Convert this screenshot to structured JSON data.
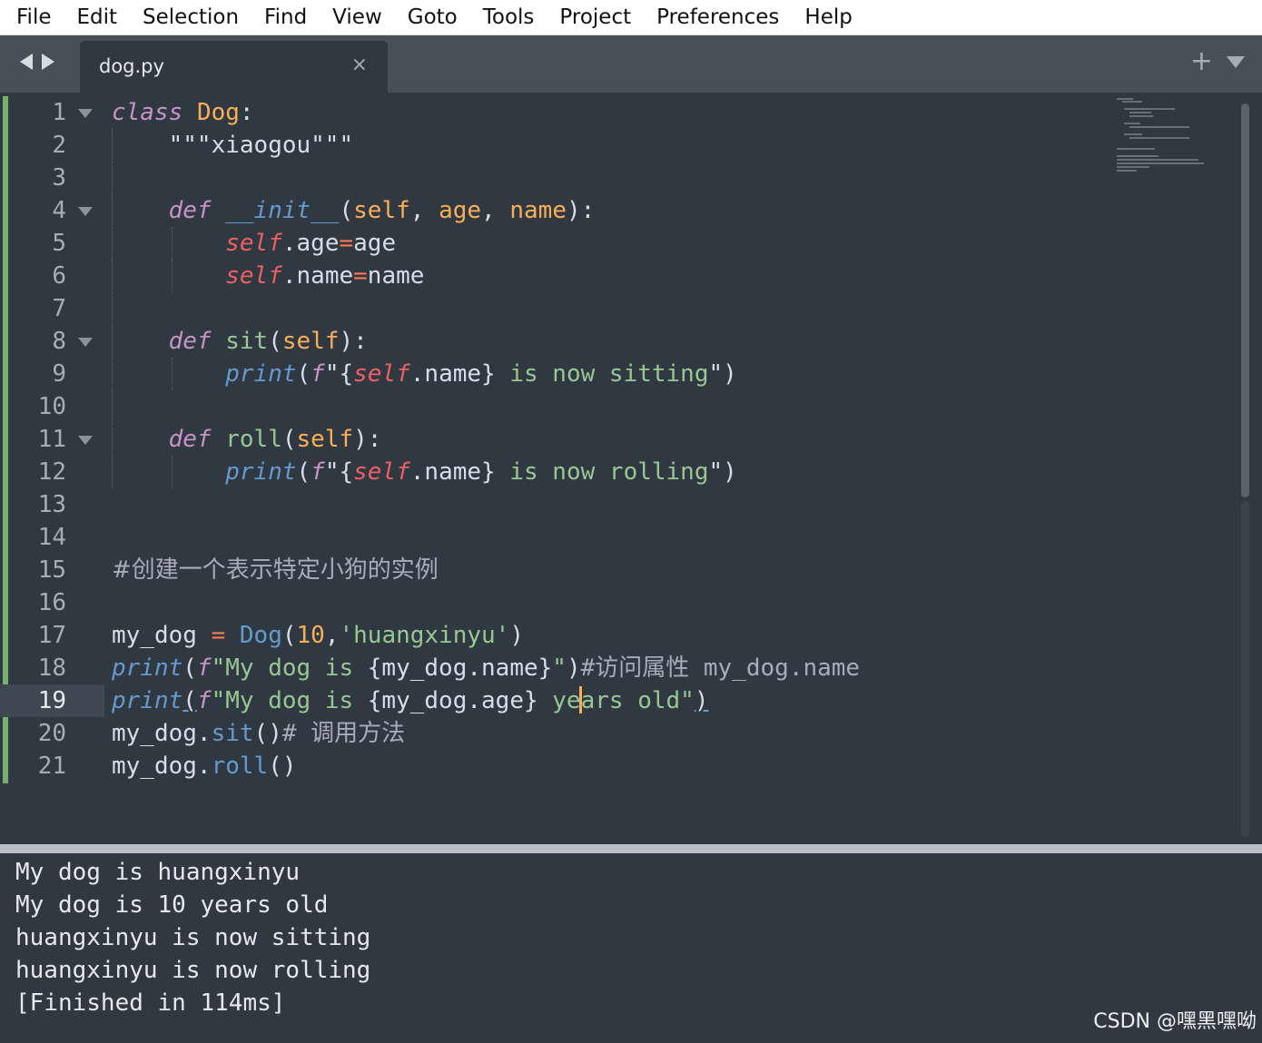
{
  "menu": [
    "File",
    "Edit",
    "Selection",
    "Find",
    "View",
    "Goto",
    "Tools",
    "Project",
    "Preferences",
    "Help"
  ],
  "tab": {
    "title": "dog.py",
    "close_glyph": "×",
    "plus_glyph": "+"
  },
  "editor": {
    "active_line": 19,
    "line_numbers": [
      "1",
      "2",
      "3",
      "4",
      "5",
      "6",
      "7",
      "8",
      "9",
      "10",
      "11",
      "12",
      "13",
      "14",
      "15",
      "16",
      "17",
      "18",
      "19",
      "20",
      "21"
    ],
    "lines": {
      "l1": [
        "class",
        " ",
        "Dog",
        ":"
      ],
      "l2": [
        "\"\"\"xiaogou\"\"\""
      ],
      "l4": [
        "def",
        " ",
        "__init__",
        "(",
        "self",
        ", ",
        "age",
        ", ",
        "name",
        "):"
      ],
      "l5": [
        "self",
        ".age",
        "=",
        "age"
      ],
      "l6": [
        "self",
        ".name",
        "=",
        "name"
      ],
      "l8": [
        "def",
        " ",
        "sit",
        "(",
        "self",
        "):"
      ],
      "l9": [
        "print",
        "(",
        "f",
        "\"",
        "{",
        "self",
        ".name}",
        " is now sitting",
        "\"",
        ")"
      ],
      "l11": [
        "def",
        " ",
        "roll",
        "(",
        "self",
        "):"
      ],
      "l12": [
        "print",
        "(",
        "f",
        "\"",
        "{",
        "self",
        ".name}",
        " is now rolling",
        "\"",
        ")"
      ],
      "l15": [
        "#创建一个表示特定小狗的实例"
      ],
      "l17": [
        "my_dog",
        " ",
        "=",
        " ",
        "Dog",
        "(",
        "10",
        ",",
        "'huangxinyu'",
        ")"
      ],
      "l18": [
        "print",
        "(",
        "f",
        "\"My dog is ",
        "{my_dog.name}",
        "\"",
        ")",
        "#访问属性 my_dog.name"
      ],
      "l19": [
        "print",
        "(",
        "f",
        "\"My dog is ",
        "{my_dog.age}",
        " ye",
        "ars old\"",
        ")"
      ],
      "l20": [
        "my_dog",
        ".",
        "sit",
        "()",
        "# 调用方法"
      ],
      "l21": [
        "my_dog",
        ".",
        "roll",
        "()"
      ]
    }
  },
  "output": [
    "My dog is huangxinyu",
    "My dog is 10 years old",
    "huangxinyu is now sitting",
    "huangxinyu is now rolling",
    "[Finished in 114ms]"
  ],
  "watermark": "CSDN @嘿黑嘿呦",
  "colors": {
    "background": "#303841",
    "keyword": "#c594c5",
    "string": "#99c794",
    "function": "#6699cc",
    "self": "#ec5f66",
    "param": "#f9ae58",
    "changed_gutter": "#77b06b"
  }
}
